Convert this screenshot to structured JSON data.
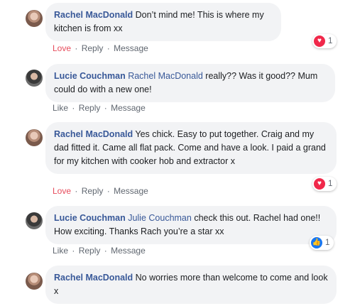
{
  "comments": [
    {
      "author": "Rachel MacDonald",
      "tag": "",
      "text": "Don’t mind me! This is where my kitchen is from xx",
      "actions": {
        "react": "Love",
        "reply": "Reply",
        "message": "Message"
      },
      "reaction": {
        "icon": "heart-icon",
        "count": "1"
      }
    },
    {
      "author": "Lucie Couchman",
      "tag": "Rachel MacDonald",
      "text": "really?? Was it good?? Mum could do with a new one!",
      "actions": {
        "react": "Like",
        "reply": "Reply",
        "message": "Message"
      }
    },
    {
      "author": "Rachel MacDonald",
      "tag": "",
      "text": "Yes chick. Easy to put together. Craig and my dad fitted it. Came all flat pack. Come and have a look. I paid a grand for my kitchen with cooker hob and extractor x",
      "actions": {
        "react": "Love",
        "reply": "Reply",
        "message": "Message"
      },
      "reaction": {
        "icon": "heart-icon",
        "count": "1"
      }
    },
    {
      "author": "Lucie Couchman",
      "tag": "Julie Couchman",
      "text": "check this out. Rachel had one!! How exciting. Thanks Rach you’re a star xx",
      "actions": {
        "react": "Like",
        "reply": "Reply",
        "message": "Message"
      },
      "reaction": {
        "icon": "thumbs-up-icon",
        "count": "1"
      }
    },
    {
      "author": "Rachel MacDonald",
      "tag": "",
      "text": "No worries more than welcome to come and look x"
    }
  ],
  "separator": "·",
  "colors": {
    "link": "#385898",
    "love": "#e74c5c",
    "bubble": "#f2f3f5",
    "meta": "#606770"
  }
}
